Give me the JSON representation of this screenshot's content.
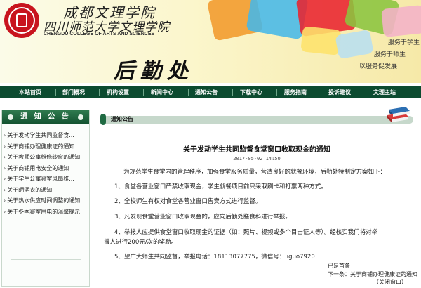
{
  "banner": {
    "school_name_cn_line1": "成都文理学院",
    "school_name_cn_line2": "四川师范大学文理学院",
    "school_name_en": "CHENGDU COLLEGE OF ARTS AND SCIENCES",
    "department_title": "后勤处",
    "slogans": [
      "服务于学生",
      "服务于师生",
      "以服务促发展"
    ],
    "colors": {
      "accent_red": "#c8141e",
      "nav_green": "#0c4b30"
    }
  },
  "nav": {
    "items": [
      "本站首页",
      "部门概况",
      "机构设置",
      "新闻中心",
      "通知公告",
      "下载中心",
      "服务指南",
      "投诉建议",
      "文理主站"
    ]
  },
  "sidebar": {
    "title": "通 知 公 告",
    "items": [
      "关于发动学生共同监督食...",
      "关于商铺办理健康证的通知",
      "关于教师公寓维修纱窗的通知",
      "关于商铺用电安全的通知",
      "关于学生公寓寝室风扇维...",
      "关于晒酒衣的通知",
      "关于热水供应时间调整的通知",
      "关于冬季寝室用电的温馨提示"
    ]
  },
  "main": {
    "section_label": "通知公告",
    "article": {
      "title": "关于发动学生共同监督食堂窗口收取现金的通知",
      "date": "2017-05-02 14:50",
      "intro": "为规范学生食堂内的管理秩序，加强食堂服务质量，营造良好的就餐环境，后勤处特制定方案如下：",
      "p1": "1、食堂各营业窗口严禁收取现金，学生就餐项目前只采取刷卡和打票两种方式。",
      "p2": "2、全校师生有权对食堂各营业窗口售卖方式进行监督。",
      "p3": "3、凡发现食堂营业窗口收取现金的，应向后勤处膳食科进行举报。",
      "p4_line1": "4、举报人应提供食堂窗口收取现金的证据（如：照片、视频或多个目击证人等）。经核实我们将对举",
      "p4_line2": "报人进行200元/次的奖励。",
      "p5": "5、望广大师生共同监督，举报电话：18113077775，微信号：liguo7920"
    },
    "prev": "已是首条",
    "next": "下一条：关于商铺办理健康证的通知",
    "close": "【关闭窗口】"
  }
}
